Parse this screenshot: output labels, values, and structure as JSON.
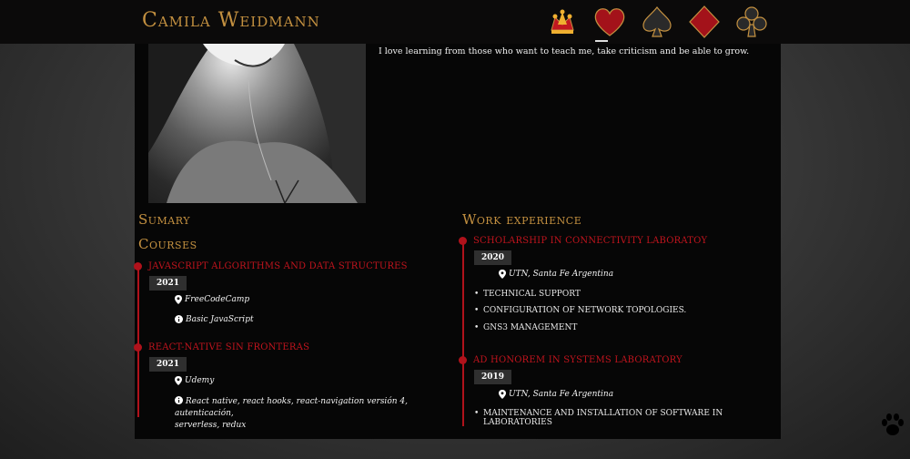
{
  "header": {
    "brand": "Camila Weidmann",
    "nav": [
      {
        "icon": "jester-hat-icon",
        "color": "#c21820",
        "active": false
      },
      {
        "icon": "heart-icon",
        "color": "#a3121a",
        "active": true
      },
      {
        "icon": "spade-icon",
        "color": "#2a2a2a",
        "active": false
      },
      {
        "icon": "diamond-icon",
        "color": "#a3121a",
        "active": false
      },
      {
        "icon": "club-icon",
        "color": "#2a2a2a",
        "active": false
      }
    ]
  },
  "intro": "I love learning from those who want to teach me, take criticism and be able to grow.",
  "sections": {
    "summary_title": "Sumary",
    "courses_title": "Courses",
    "work_title": "Work experience"
  },
  "courses": [
    {
      "title": "Javascript algorithms and data structures",
      "year": "2021",
      "place": "FreeCodeCamp",
      "info": "Basic JavaScript"
    },
    {
      "title": "React-Native sin fronteras",
      "year": "2021",
      "place": "Udemy",
      "info": "React native, react hooks, react-navigation versión 4, autenticación,",
      "info2": "serverless, redux"
    }
  ],
  "work": [
    {
      "title": "Scholarship in connectivity laboratoy",
      "year": "2020",
      "place": "UTN, Santa Fe Argentina",
      "tasks": [
        "Technical support",
        "Configuration of network topologies.",
        "GNS3 management"
      ]
    },
    {
      "title": "Ad Honorem in systems laboratory",
      "year": "2019",
      "place": "UTN, Santa Fe Argentina",
      "tasks": [
        "Maintenance and installation of software in laboratories"
      ]
    }
  ],
  "colors": {
    "accent_gold": "#c39040",
    "accent_red": "#b0121b",
    "panel": "#060606"
  }
}
